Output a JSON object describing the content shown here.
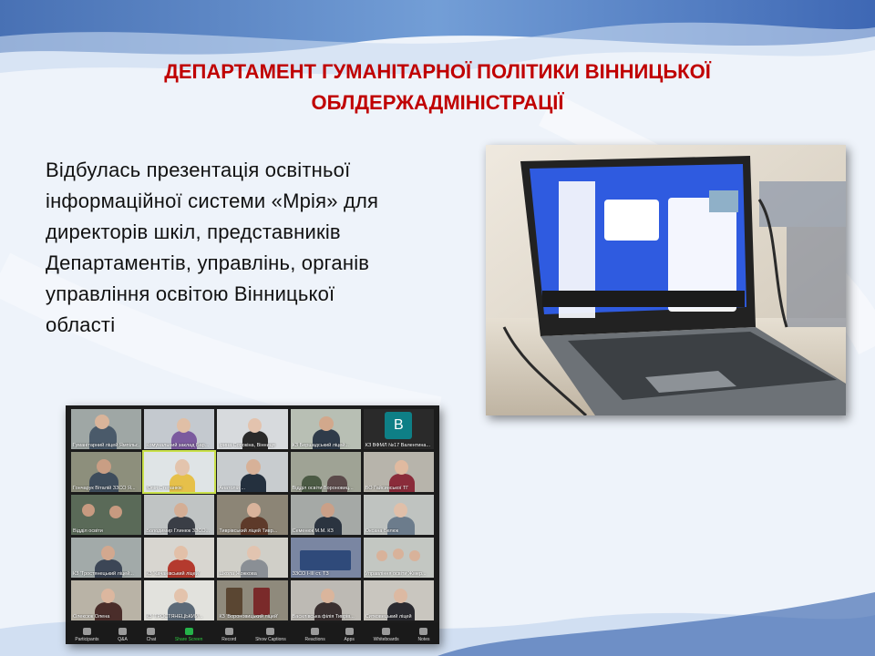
{
  "slide": {
    "title_line1": "ДЕПАРТАМЕНТ ГУМАНІТАРНОЇ ПОЛІТИКИ ВІННИЦЬКОЇ",
    "title_line2": "ОБЛДЕРЖАДМІНІСТРАЦІЇ",
    "body_lines": [
      "Відбулась презентація освітньої",
      "інформаційної системи «Мрія» для",
      "директорів шкіл, представників",
      "Департаментів, управлінь, органів",
      "управління освітою Вінницької",
      "області"
    ]
  },
  "colors": {
    "title": "#c00000",
    "accent_blue": "#1f4fa8",
    "background": "#eef3fa"
  },
  "zoom": {
    "tiles": [
      "Гуманітарний ліцей Ямпільс...",
      "Комунальний заклад Бар...",
      "Ірина Сорокіна, Вінниця",
      "КЗ Бершадський ліцей...",
      "КЗ ВФМЛ №17 Валентина...",
      "Гончарук Віталій ЗЗСО Я...",
      "Юлія Степанюк",
      "Анатолій ...",
      "Відділ освіти Вороновиц...",
      "ВО Гайсинської ТГ",
      "Відділ освіти",
      "Володимир Глинюк ЗЗСО...",
      "Тиврівський ліцей Тивр...",
      "Семенюк М.М. КЗ",
      "Оксана Белюк",
      "КЗ 'Тростянецький ліцей...",
      "КЗ 'Качанівський ліцей'",
      "Школа Жожкова",
      "ЗЗСО І-ІІІ ст. ТЗ",
      "Управління освіти Жмер...",
      "Олексюк Олена",
      "КЗ 'ТРОСТЯНЕЦЬКИЙ...",
      "КЗ 'Вороновицький ліцей'",
      "Василівська філія Тиврів...",
      "Ситковецький ліцей"
    ],
    "avatar_letter": "B",
    "toolbar": [
      "Participants",
      "Q&A",
      "Chat",
      "Share Screen",
      "Record",
      "Show Captions",
      "Reactions",
      "Apps",
      "Whiteboards",
      "Notes"
    ]
  }
}
